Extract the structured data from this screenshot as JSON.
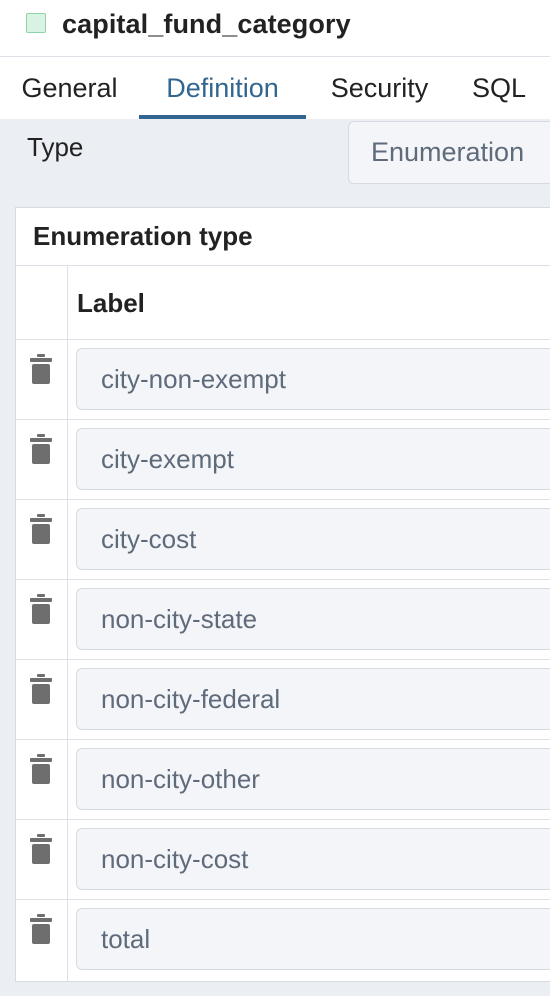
{
  "header": {
    "title": "capital_fund_category",
    "icon": "type-icon"
  },
  "tabs": [
    {
      "label": "General",
      "active": false
    },
    {
      "label": "Definition",
      "active": true
    },
    {
      "label": "Security",
      "active": false
    },
    {
      "label": "SQL",
      "active": false
    }
  ],
  "definition": {
    "type_label": "Type",
    "type_value": "Enumeration"
  },
  "enumeration": {
    "section_title": "Enumeration type",
    "column_label": "Label",
    "rows": [
      {
        "label": "city-non-exempt"
      },
      {
        "label": "city-exempt"
      },
      {
        "label": "city-cost"
      },
      {
        "label": "non-city-state"
      },
      {
        "label": "non-city-federal"
      },
      {
        "label": "non-city-other"
      },
      {
        "label": "non-city-cost"
      },
      {
        "label": "total"
      }
    ]
  },
  "colors": {
    "accent": "#326690",
    "icon_green": "#8fd3a9",
    "trash": "#6e6e6e"
  }
}
